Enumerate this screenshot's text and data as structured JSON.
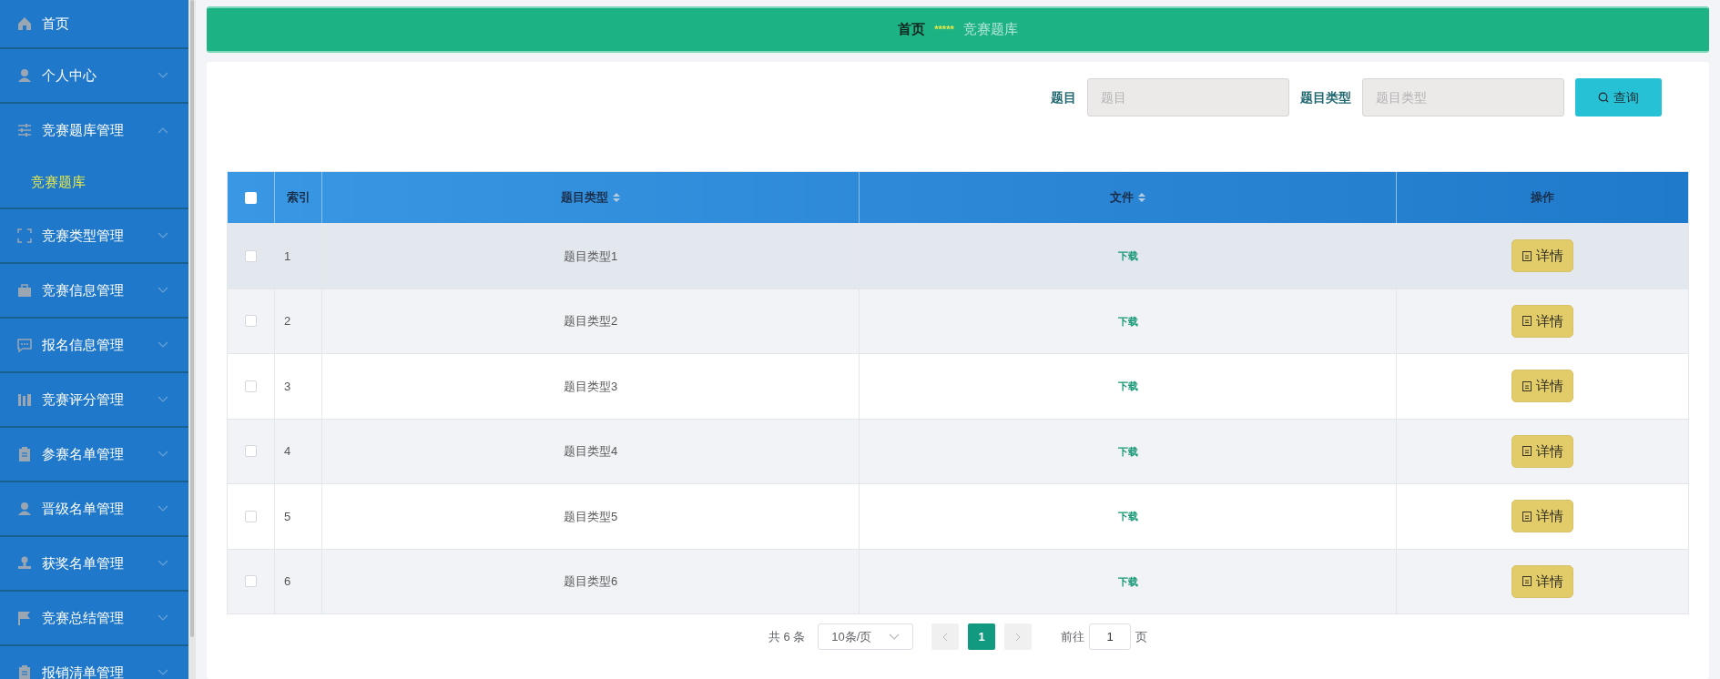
{
  "sidebar": {
    "items": [
      {
        "label": "首页",
        "expandable": false
      },
      {
        "label": "个人中心",
        "expandable": true,
        "expanded": false
      },
      {
        "label": "竞赛题库管理",
        "expandable": true,
        "expanded": true,
        "children": [
          {
            "label": "竞赛题库",
            "selected": true
          }
        ]
      },
      {
        "label": "竞赛类型管理",
        "expandable": true,
        "expanded": false
      },
      {
        "label": "竞赛信息管理",
        "expandable": true,
        "expanded": false
      },
      {
        "label": "报名信息管理",
        "expandable": true,
        "expanded": false
      },
      {
        "label": "竞赛评分管理",
        "expandable": true,
        "expanded": false
      },
      {
        "label": "参赛名单管理",
        "expandable": true,
        "expanded": false
      },
      {
        "label": "晋级名单管理",
        "expandable": true,
        "expanded": false
      },
      {
        "label": "获奖名单管理",
        "expandable": true,
        "expanded": false
      },
      {
        "label": "竞赛总结管理",
        "expandable": true,
        "expanded": false
      },
      {
        "label": "报销清单管理",
        "expandable": true,
        "expanded": false
      }
    ]
  },
  "breadcrumb": {
    "items": [
      "首页",
      "竞赛题库"
    ],
    "separator": "*****"
  },
  "search": {
    "fields": [
      {
        "label": "题目",
        "placeholder": "题目"
      },
      {
        "label": "题目类型",
        "placeholder": "题目类型"
      }
    ],
    "button": "查询"
  },
  "table": {
    "select_all_checked": false,
    "columns": [
      {
        "label": "索引"
      },
      {
        "label": "题目类型",
        "sortable": true
      },
      {
        "label": "文件",
        "sortable": true
      },
      {
        "label": "操作"
      }
    ],
    "rows": [
      {
        "index": "1",
        "type": "题目类型1",
        "file": "下载",
        "action": "详情",
        "checked": false,
        "highlighted": true
      },
      {
        "index": "2",
        "type": "题目类型2",
        "file": "下载",
        "action": "详情",
        "checked": false,
        "highlighted": false
      },
      {
        "index": "3",
        "type": "题目类型3",
        "file": "下载",
        "action": "详情",
        "checked": false,
        "highlighted": false
      },
      {
        "index": "4",
        "type": "题目类型4",
        "file": "下载",
        "action": "详情",
        "checked": false,
        "highlighted": false
      },
      {
        "index": "5",
        "type": "题目类型5",
        "file": "下载",
        "action": "详情",
        "checked": false,
        "highlighted": false
      },
      {
        "index": "6",
        "type": "题目类型6",
        "file": "下载",
        "action": "详情",
        "checked": false,
        "highlighted": false
      }
    ]
  },
  "pagination": {
    "total": "共 6 条",
    "page_size": "10条/页",
    "pages": [
      {
        "label": "1",
        "selected": true
      }
    ],
    "goto_label": "前往",
    "goto_value": "1",
    "goto_suffix": "页"
  }
}
